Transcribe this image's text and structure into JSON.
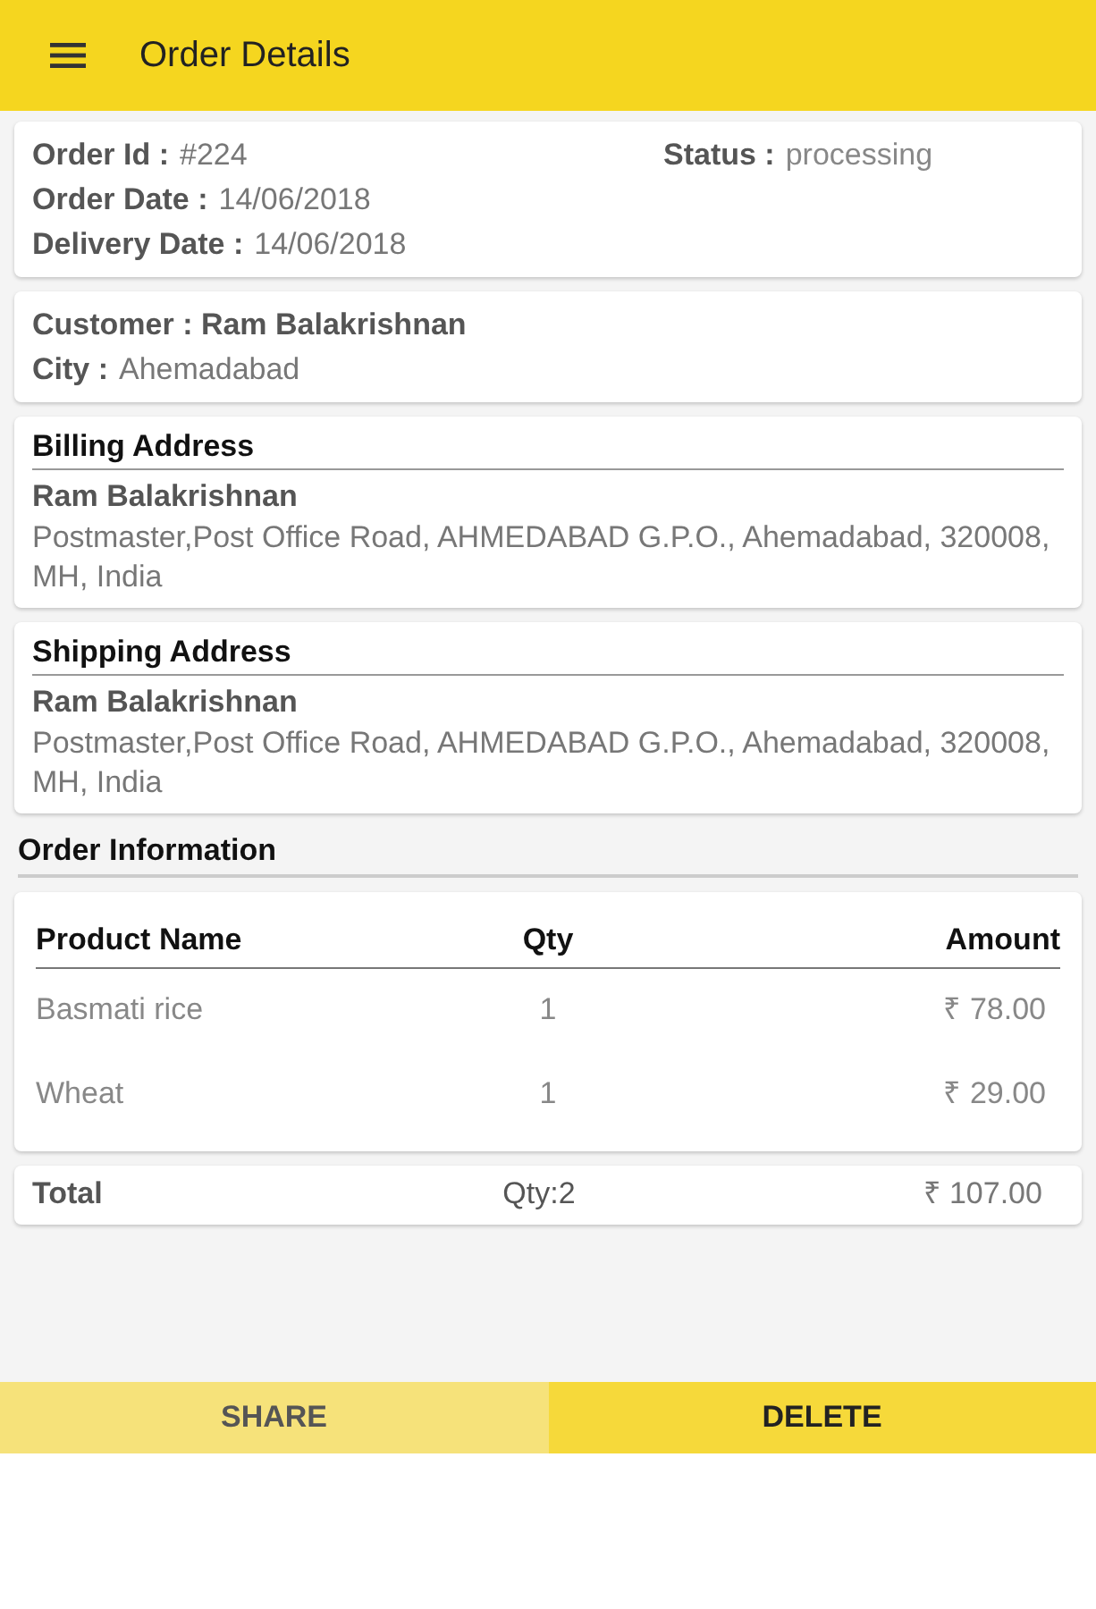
{
  "app_bar": {
    "title": "Order Details"
  },
  "order": {
    "fields": [
      {
        "label": "Order Id :",
        "value": "#224"
      },
      {
        "label": "Order Date :",
        "value": "14/06/2018"
      },
      {
        "label": "Delivery Date :",
        "value": "14/06/2018"
      }
    ],
    "status": {
      "label": "Status :",
      "value": "processing"
    }
  },
  "customer": {
    "name_line": "Customer : Ram Balakrishnan",
    "city_label": "City :",
    "city": "Ahemadabad"
  },
  "addresses": [
    {
      "heading": "Billing Address",
      "name": "Ram Balakrishnan",
      "address": "Postmaster,Post Office Road, AHMEDABAD G.P.O., Ahemadabad, 320008, MH, India"
    },
    {
      "heading": "Shipping Address",
      "name": "Ram Balakrishnan",
      "address": "Postmaster,Post Office Road, AHMEDABAD G.P.O., Ahemadabad, 320008, MH, India"
    }
  ],
  "order_information": {
    "heading": "Order Information",
    "table": {
      "columns": [
        "Product Name",
        "Qty",
        "Amount"
      ],
      "rows": [
        [
          "Basmati rice",
          "1",
          "₹ 78.00"
        ],
        [
          "Wheat",
          "1",
          "₹ 29.00"
        ]
      ]
    },
    "total": {
      "label": "Total",
      "qty": "Qty:2",
      "amount": "₹ 107.00"
    }
  },
  "actions": [
    {
      "label": "SHARE",
      "kind": "secondary"
    },
    {
      "label": "DELETE",
      "kind": "primary"
    }
  ]
}
